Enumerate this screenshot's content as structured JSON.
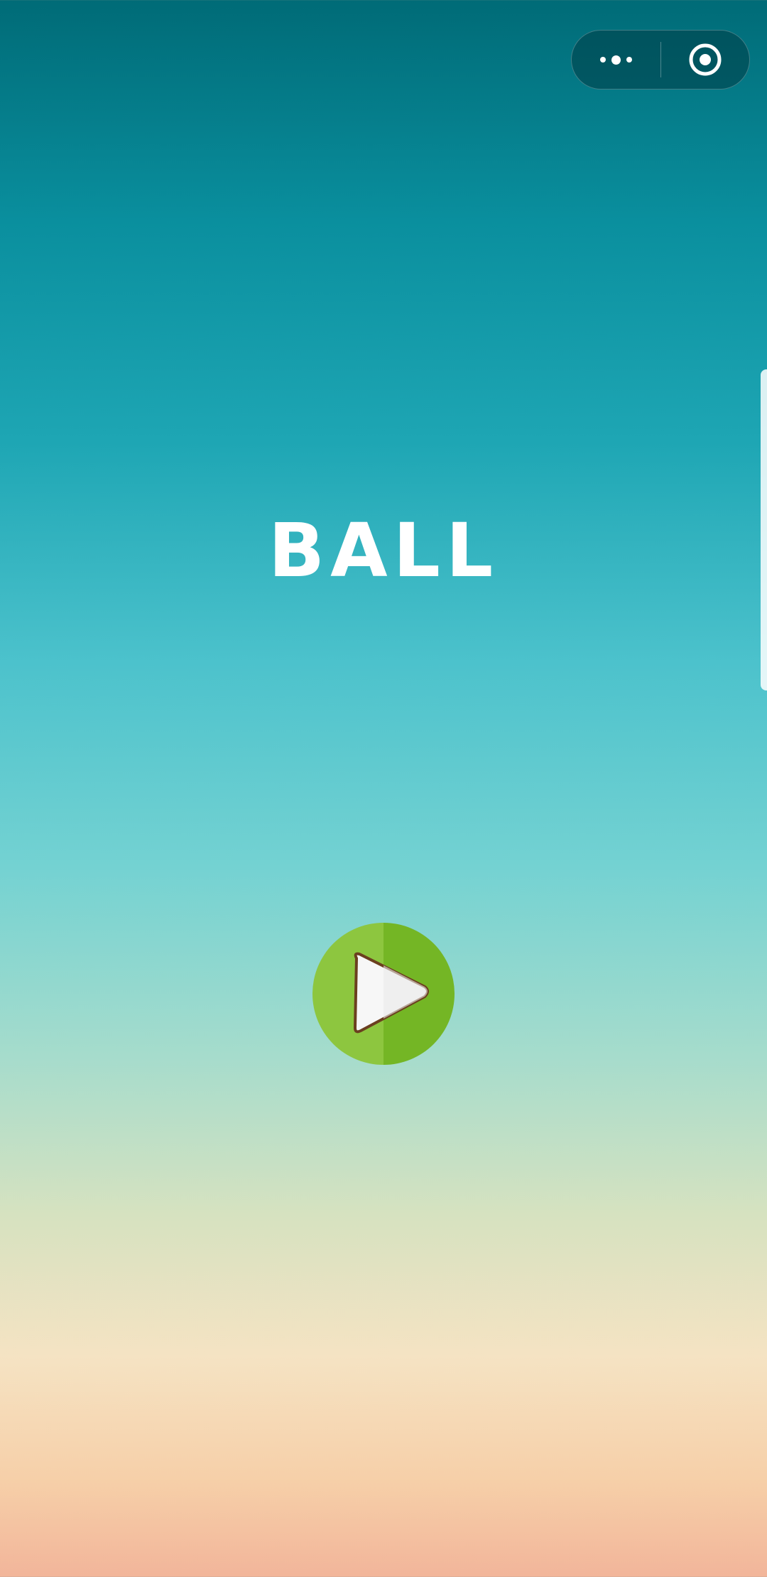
{
  "game": {
    "title": "BALL"
  },
  "top_bar": {
    "capsule_icons": [
      "more-icon",
      "close-target-icon"
    ]
  },
  "controls": {
    "play_icon": "play-icon"
  },
  "colors": {
    "play_green_light": "#8dc63f",
    "play_green_dark": "#74b625",
    "play_outline": "#6b3f1f",
    "title_color": "#ffffff"
  }
}
